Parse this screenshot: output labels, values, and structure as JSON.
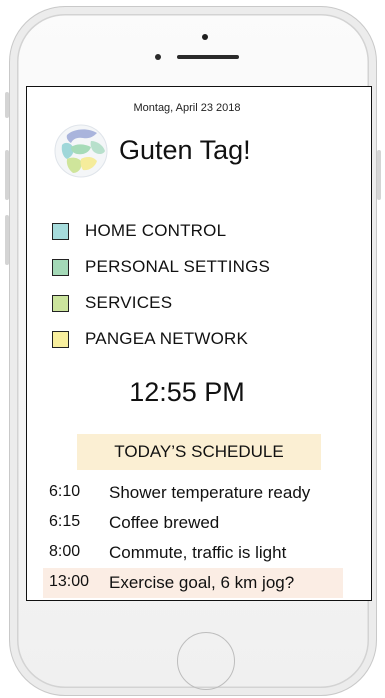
{
  "screen": {
    "date": "Montag, April 23 2018",
    "greeting": "Guten Tag!",
    "logo_icon": "globe-icon",
    "menu": [
      {
        "label": "HOME CONTROL",
        "color": "#a6dcdc"
      },
      {
        "label": "PERSONAL SETTINGS",
        "color": "#a4d9b7"
      },
      {
        "label": "SERVICES",
        "color": "#cbe49d"
      },
      {
        "label": "PANGEA NETWORK",
        "color": "#f8ef9e"
      }
    ],
    "clock": "12:55 PM",
    "schedule": {
      "header": "TODAY’S SCHEDULE",
      "header_bg": "#fbefd3",
      "highlight_bg": "#fbede4",
      "items": [
        {
          "time": "6:10",
          "text": "Shower temperature ready"
        },
        {
          "time": "6:15",
          "text": "Coffee brewed"
        },
        {
          "time": "8:00",
          "text": "Commute, traffic is light"
        },
        {
          "time": "13:00",
          "text": "Exercise goal, 6 km jog?"
        }
      ]
    }
  }
}
